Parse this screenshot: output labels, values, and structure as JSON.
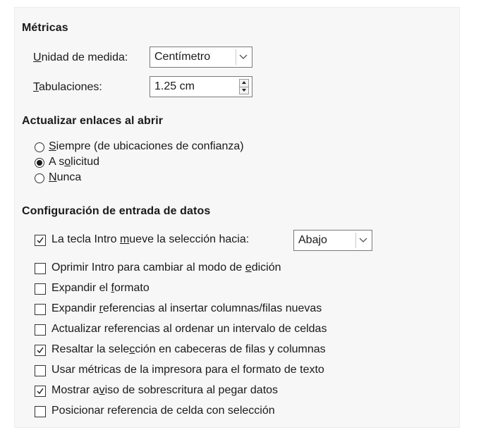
{
  "metrics": {
    "title": "Métricas",
    "unit_label_pre": "",
    "unit_label_ul": "U",
    "unit_label_post": "nidad de medida:",
    "unit_value": "Centímetro",
    "tab_label_ul": "T",
    "tab_label_post": "abulaciones:",
    "tab_value": "1.25 cm"
  },
  "links": {
    "title": "Actualizar enlaces al abrir",
    "options": [
      {
        "pre": "",
        "ul": "S",
        "post": "iempre (de ubicaciones de confianza)",
        "selected": false
      },
      {
        "pre": "A s",
        "ul": "o",
        "post": "licitud",
        "selected": true
      },
      {
        "pre": "",
        "ul": "N",
        "post": "unca",
        "selected": false
      }
    ]
  },
  "input": {
    "title": "Configuración de entrada de datos",
    "direction_value": "Abajo",
    "options": [
      {
        "pre": "La tecla Intro ",
        "ul": "m",
        "post": "ueve la selección hacia:",
        "checked": true
      },
      {
        "pre": "Oprimir Intro para cambiar al modo de ",
        "ul": "e",
        "post": "dición",
        "checked": false
      },
      {
        "pre": "Expandir el ",
        "ul": "f",
        "post": "ormato",
        "checked": false
      },
      {
        "pre": "Expandir ",
        "ul": "r",
        "post": "eferencias al insertar columnas/filas nuevas",
        "checked": false
      },
      {
        "pre": "Actualizar referencias al ordenar un intervalo de celdas",
        "ul": "",
        "post": "",
        "checked": false
      },
      {
        "pre": "Resaltar la sele",
        "ul": "c",
        "post": "ción en cabeceras de filas y columnas",
        "checked": true
      },
      {
        "pre": "Usar métricas de la impresora para el formato de texto",
        "ul": "",
        "post": "",
        "checked": false
      },
      {
        "pre": "Mostrar a",
        "ul": "v",
        "post": "iso de sobrescritura al pegar datos",
        "checked": true
      },
      {
        "pre": "Posicionar referencia de celda con selección",
        "ul": "",
        "post": "",
        "checked": false
      }
    ]
  }
}
